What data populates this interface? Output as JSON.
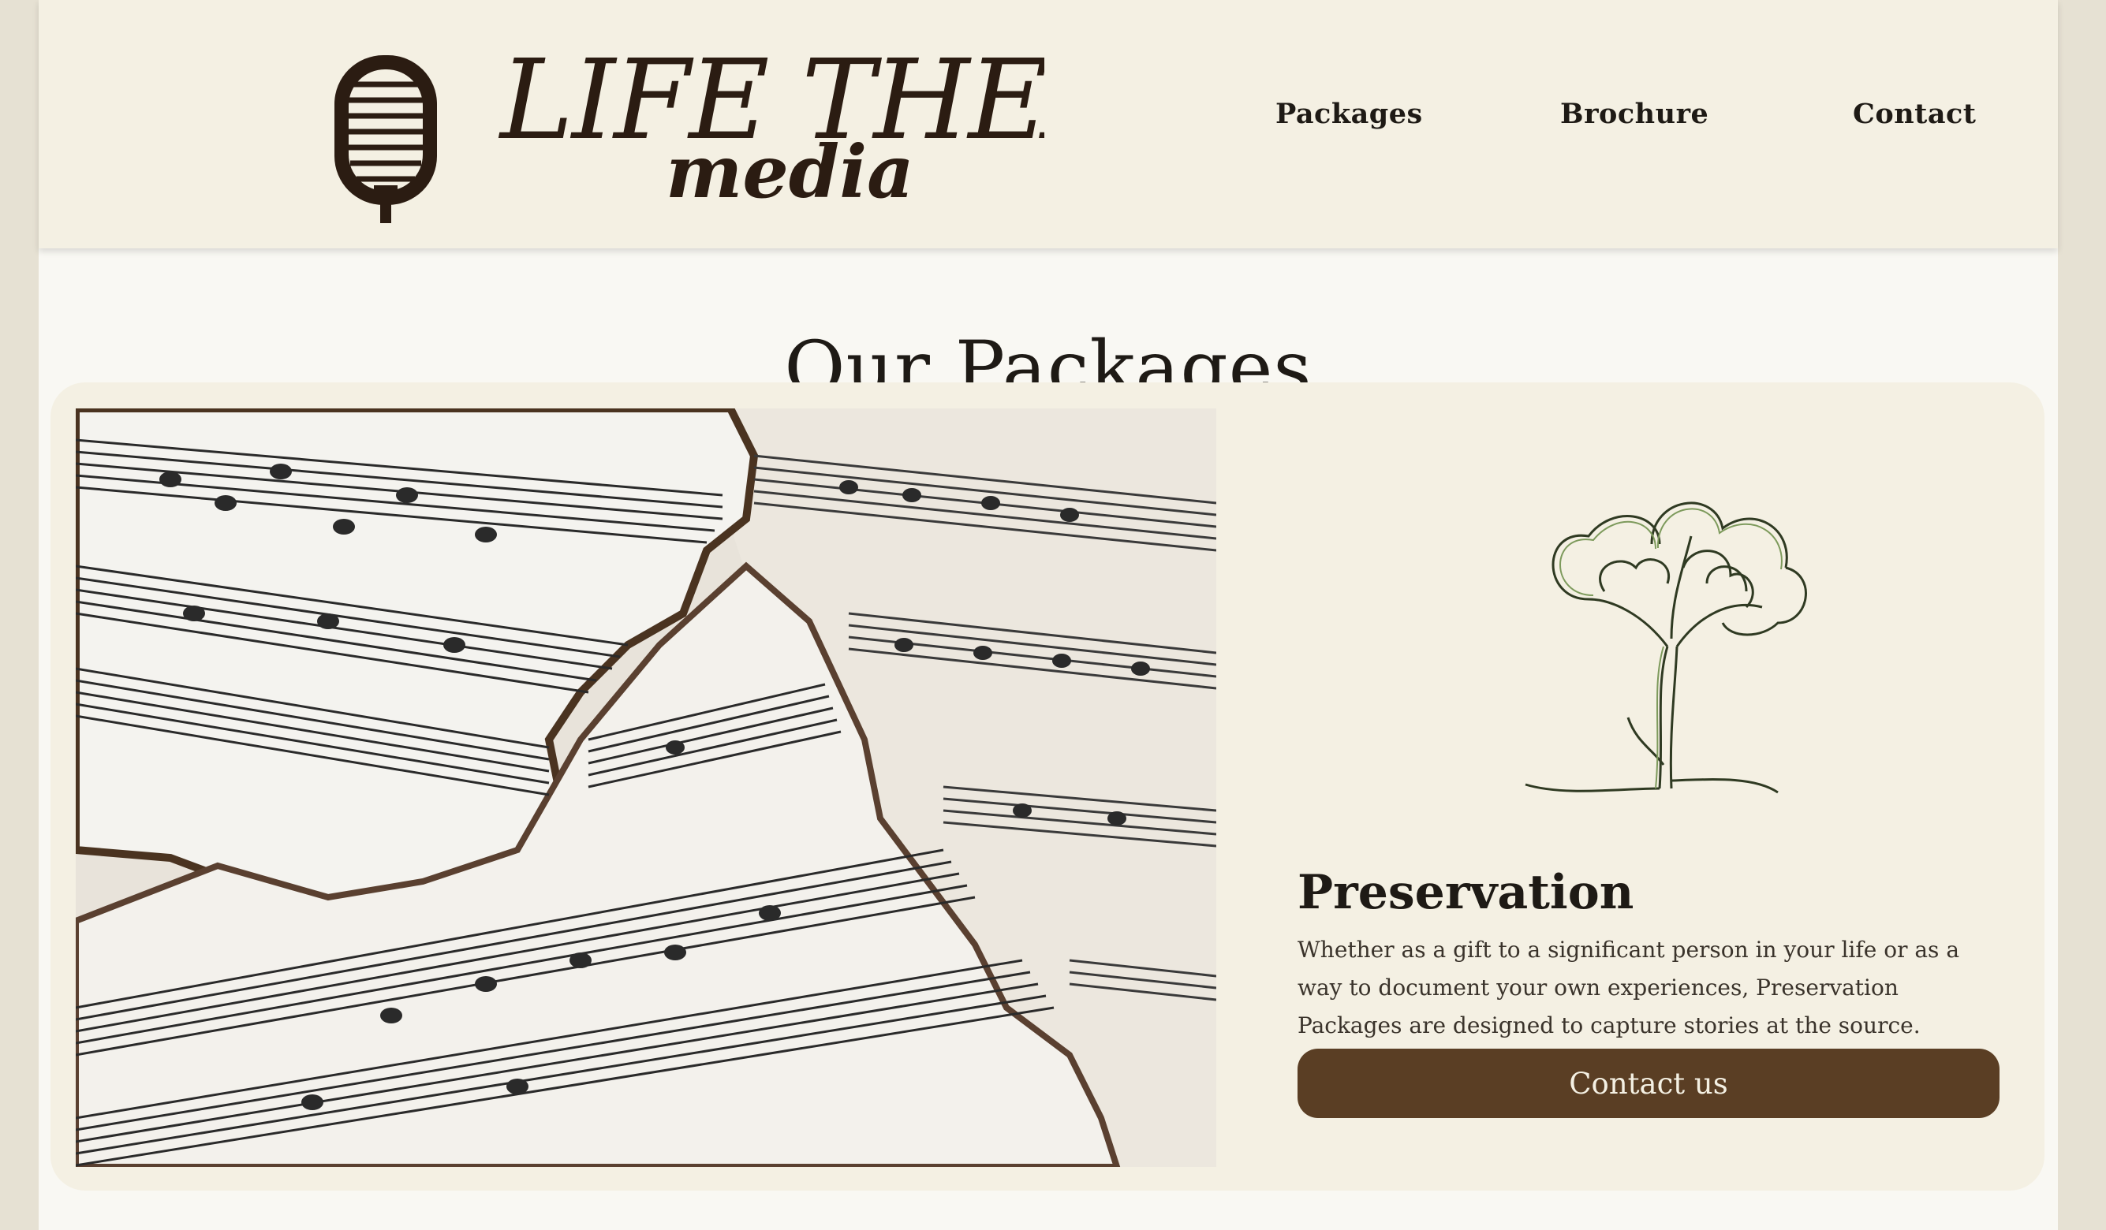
{
  "brand": {
    "logo_line1": "LIFE THEATER",
    "logo_line2": "media"
  },
  "nav": {
    "items": [
      {
        "label": "Packages"
      },
      {
        "label": "Brochure"
      },
      {
        "label": "Contact"
      }
    ]
  },
  "main": {
    "title": "Our Packages",
    "package": {
      "title": "Preservation",
      "description": "Whether as a gift to a significant person in your life or as a way to document your own experiences, Preservation Packages are designed to capture stories at the source.",
      "button_label": "Contact us"
    }
  },
  "colors": {
    "header_bg": "#f4f0e3",
    "page_bg": "#f9f8f3",
    "card_bg": "#f4f0e3",
    "accent_button": "#5a3e24",
    "text": "#1e1a15"
  },
  "icons": [
    "microphone-icon",
    "tree-icon"
  ]
}
